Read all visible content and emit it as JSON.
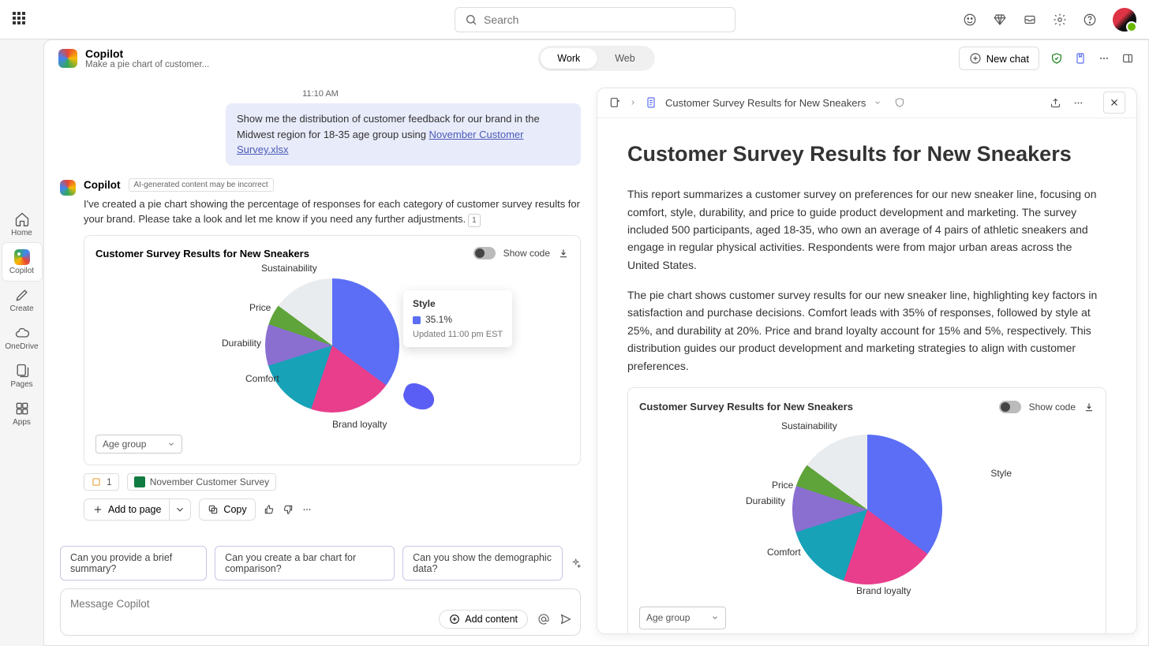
{
  "top": {
    "search_placeholder": "Search"
  },
  "rail": {
    "home": "Home",
    "copilot": "Copilot",
    "create": "Create",
    "onedrive": "OneDrive",
    "pages": "Pages",
    "apps": "Apps"
  },
  "header": {
    "title": "Copilot",
    "subtitle": "Make a pie chart of customer...",
    "tab_work": "Work",
    "tab_web": "Web",
    "new_chat": "New chat"
  },
  "chat": {
    "timestamp": "11:10 AM",
    "user_msg_prefix": "Show me the distribution of customer feedback for our brand in the Midwest region for 18-35 age group using  ",
    "user_msg_link": "November Customer Survey.xlsx",
    "assistant_name": "Copilot",
    "warn": "AI-generated content may be incorrect",
    "assistant_text": "I've created a pie chart showing the percentage of responses for each category of customer survey results for your brand. Please take a look and let me know if you need any further adjustments.",
    "ref_num": "1"
  },
  "chart": {
    "title": "Customer Survey Results for New Sneakers",
    "show_code": "Show code",
    "tooltip_title": "Style",
    "tooltip_value": "35.1%",
    "tooltip_updated": "Updated 11:00 pm EST",
    "age_label": "Age group",
    "labels": {
      "sustainability": "Sustainability",
      "price": "Price",
      "durability": "Durability",
      "comfort": "Comfort",
      "brand": "Brand loyalty",
      "style": "Style"
    }
  },
  "attachments": {
    "count": "1",
    "file": "November Customer Survey"
  },
  "actions": {
    "add_page": "Add to page",
    "copy": "Copy"
  },
  "suggestions": {
    "s1": "Can you provide a brief summary?",
    "s2": "Can you create a bar chart for comparison?",
    "s3": "Can you show the demographic data?"
  },
  "input": {
    "placeholder": "Message Copilot",
    "add_content": "Add content"
  },
  "panel": {
    "doc_title": "Customer Survey Results for New Sneakers",
    "h1": "Customer Survey Results for New Sneakers",
    "p1": "This report summarizes a customer survey on preferences for our new sneaker line, focusing on comfort, style, durability, and price to guide product development and marketing. The survey included 500 participants, aged 18-35, who own an average of 4 pairs of athletic sneakers and engage in regular physical activities. Respondents were from major urban areas across the United States.",
    "p2": "The pie chart shows customer survey results for our new sneaker line, highlighting key factors in satisfaction and purchase decisions. Comfort leads with 35% of responses, followed by style at 25%, and durability at 20%. Price and brand loyalty account for 15% and 5%, respectively. This distribution guides our product development and marketing strategies to align with customer preferences."
  },
  "chart_data": {
    "type": "pie",
    "title": "Customer Survey Results for New Sneakers",
    "series": [
      {
        "name": "Style",
        "value": 35.1,
        "color": "#5b6ef5"
      },
      {
        "name": "Brand loyalty",
        "value": 20,
        "color": "#e83e8c"
      },
      {
        "name": "Comfort",
        "value": 15,
        "color": "#17a2b8"
      },
      {
        "name": "Durability",
        "value": 10,
        "color": "#8a6fd1"
      },
      {
        "name": "Price",
        "value": 5,
        "color": "#5fa43a"
      },
      {
        "name": "Sustainability",
        "value": 14.9,
        "color": "#e9ecef"
      }
    ]
  }
}
